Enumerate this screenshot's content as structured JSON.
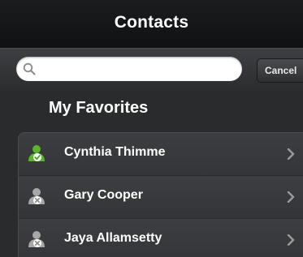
{
  "navbar": {
    "title": "Contacts"
  },
  "search": {
    "placeholder": "",
    "value": "",
    "cancel_label": "Cancel"
  },
  "favorites": {
    "header": "My Favorites",
    "contacts": [
      {
        "name": "Cynthia Thimme",
        "status": "available",
        "status_icon": "checkmark-icon",
        "status_color": "#6ec63a"
      },
      {
        "name": "Gary Cooper",
        "status": "offline",
        "status_icon": "x-icon",
        "status_color": "#9a9a9a"
      },
      {
        "name": "Jaya Allamsetty",
        "status": "offline",
        "status_icon": "x-icon",
        "status_color": "#9a9a9a"
      }
    ]
  },
  "colors": {
    "background": "#2a2b2d",
    "navbar": "#141517",
    "text": "#ffffff",
    "available": "#6ec63a",
    "offline": "#9a9a9a"
  }
}
